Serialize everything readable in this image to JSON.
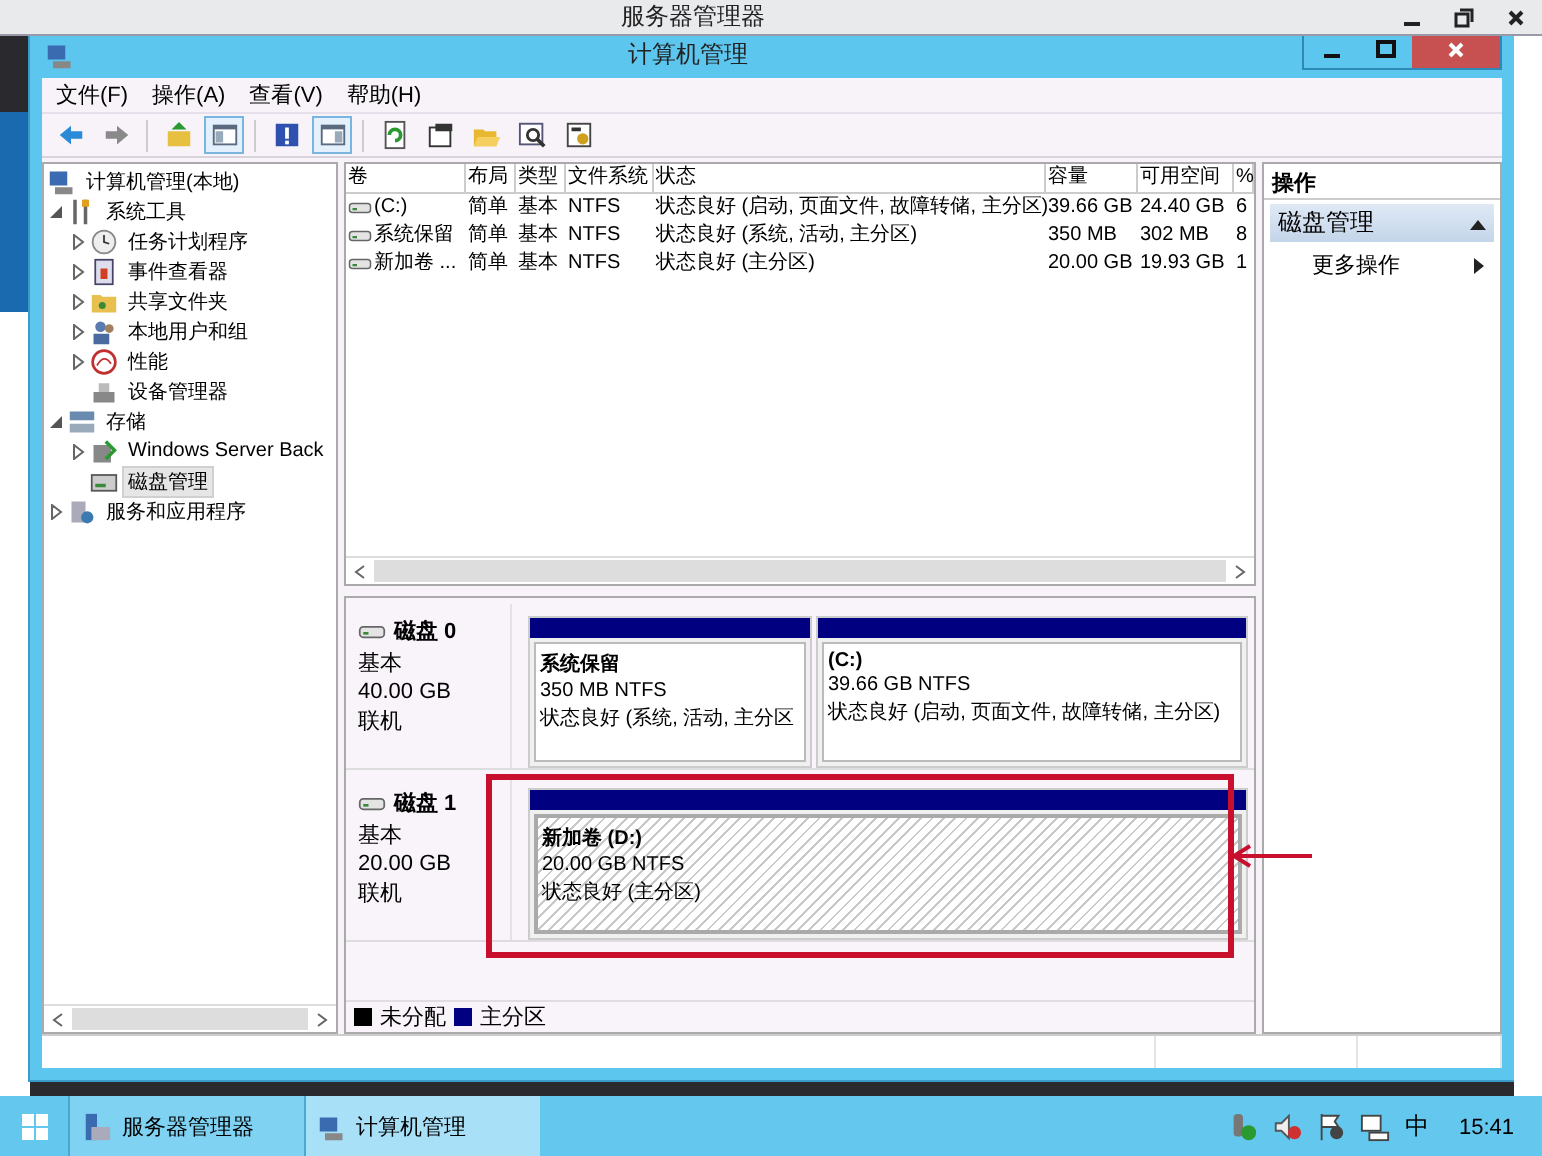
{
  "background_window": {
    "title": "服务器管理器"
  },
  "window": {
    "title": "计算机管理"
  },
  "menu": [
    "文件(F)",
    "操作(A)",
    "查看(V)",
    "帮助(H)"
  ],
  "toolbar_buttons": [
    {
      "pressed": false
    },
    {
      "pressed": false
    },
    {
      "pressed": false
    },
    {
      "pressed": true
    },
    {
      "pressed": false
    },
    {
      "pressed": true
    },
    {
      "pressed": false
    },
    {
      "pressed": false
    },
    {
      "pressed": false
    },
    {
      "pressed": false
    },
    {
      "pressed": false
    }
  ],
  "tree": [
    {
      "label": "计算机管理(本地)",
      "selected": false,
      "children": [
        {
          "label": "系统工具",
          "expanded": true,
          "selected": false,
          "children": [
            {
              "label": "任务计划程序",
              "expanded": false,
              "selected": false
            },
            {
              "label": "事件查看器",
              "expanded": false,
              "selected": false
            },
            {
              "label": "共享文件夹",
              "expanded": false,
              "selected": false
            },
            {
              "label": "本地用户和组",
              "expanded": false,
              "selected": false
            },
            {
              "label": "性能",
              "expanded": false,
              "selected": false
            },
            {
              "label": "设备管理器",
              "selected": false
            }
          ]
        },
        {
          "label": "存储",
          "expanded": true,
          "selected": false,
          "children": [
            {
              "label": "Windows Server Back",
              "expanded": false,
              "selected": false
            },
            {
              "label": "磁盘管理",
              "selected": true
            }
          ]
        },
        {
          "label": "服务和应用程序",
          "expanded": false,
          "selected": false
        }
      ]
    }
  ],
  "volume_table": {
    "columns": [
      "卷",
      "布局",
      "类型",
      "文件系统",
      "状态",
      "容量",
      "可用空间",
      "%"
    ],
    "rows": [
      [
        "(C:)",
        "简单",
        "基本",
        "NTFS",
        "状态良好 (启动, 页面文件, 故障转储, 主分区)",
        "39.66 GB",
        "24.40 GB",
        "6"
      ],
      [
        "系统保留",
        "简单",
        "基本",
        "NTFS",
        "状态良好 (系统, 活动, 主分区)",
        "350 MB",
        "302 MB",
        "8"
      ],
      [
        "新加卷 ...",
        "简单",
        "基本",
        "NTFS",
        "状态良好 (主分区)",
        "20.00 GB",
        "19.93 GB",
        "1"
      ]
    ]
  },
  "disks": [
    {
      "name": "磁盘 0",
      "type": "基本",
      "size": "40.00 GB",
      "status": "联机",
      "annotated": false,
      "partitions": [
        {
          "name": "系统保留",
          "size": "350 MB NTFS",
          "status": "状态良好 (系统, 活动, 主分区",
          "selected": false
        },
        {
          "name": "(C:)",
          "size": "39.66 GB NTFS",
          "status": "状态良好 (启动, 页面文件, 故障转储, 主分区)",
          "selected": false
        }
      ]
    },
    {
      "name": "磁盘 1",
      "type": "基本",
      "size": "20.00 GB",
      "status": "联机",
      "annotated": true,
      "partitions": [
        {
          "name": "新加卷  (D:)",
          "size": "20.00 GB NTFS",
          "status": "状态良好 (主分区)",
          "selected": true
        }
      ]
    }
  ],
  "legend": [
    {
      "label": "未分配",
      "color": "#000000"
    },
    {
      "label": "主分区",
      "color": "#000080"
    }
  ],
  "actions": {
    "title": "操作",
    "section": "磁盘管理",
    "items": [
      "更多操作"
    ]
  },
  "taskbar": {
    "items": [
      {
        "label": "服务器管理器",
        "selected": false
      },
      {
        "label": "计算机管理",
        "selected": true
      }
    ],
    "ime": "中",
    "clock": "15:41"
  }
}
